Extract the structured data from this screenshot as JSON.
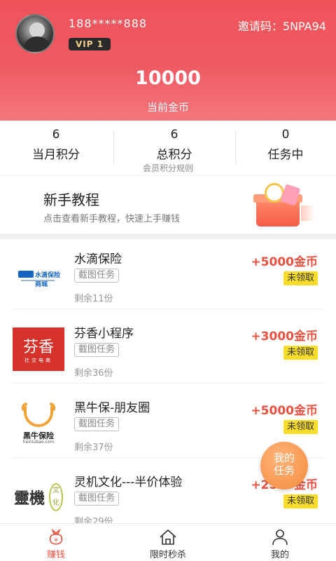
{
  "header": {
    "phone": "188*****888",
    "vip_badge": "VIP 1",
    "invite_code": "邀请码：5NPA94",
    "coins_value": "10000",
    "coins_label": "当前金币"
  },
  "stats": [
    {
      "value": "6",
      "label": "当月积分"
    },
    {
      "value": "6",
      "label": "总积分"
    },
    {
      "value": "0",
      "label": "任务中"
    }
  ],
  "rules_link": "会员积分规则",
  "tutorial": {
    "title": "新手教程",
    "subtitle": "点击查看新手教程，快速上手赚钱"
  },
  "tasks": [
    {
      "name": "水滴保险",
      "tag": "截图任务",
      "remaining": "剩余11份",
      "reward": "+5000金币",
      "status": "未领取",
      "logo_text": "水滴保险商城"
    },
    {
      "name": "芬香小程序",
      "tag": "截图任务",
      "remaining": "剩余36份",
      "reward": "+3000金币",
      "status": "未领取",
      "logo_text": "芬香",
      "logo_sub": "社交电商"
    },
    {
      "name": "黑牛保-朋友圈",
      "tag": "截图任务",
      "remaining": "剩余37份",
      "reward": "+5000金币",
      "status": "未领取",
      "logo_text": "黑牛保险",
      "logo_sub": "heiniubao.com"
    },
    {
      "name": "灵机文化---半价体验",
      "tag": "截图任务",
      "remaining": "剩余29份",
      "reward": "+2500金币",
      "status": "未领取",
      "logo_text": "靈機",
      "logo_sub": "文化"
    }
  ],
  "float_button": {
    "line1": "我的",
    "line2": "任务"
  },
  "bottom_nav": [
    {
      "label": "赚钱",
      "icon": "money-bag-icon",
      "active": true
    },
    {
      "label": "限时秒杀",
      "icon": "home-icon",
      "active": false
    },
    {
      "label": "我的",
      "icon": "user-icon",
      "active": false
    }
  ],
  "colors": {
    "header_red": "#f0525a",
    "reward_red": "#e8513f",
    "status_yellow": "#f7dc2b",
    "float_orange": "#f28a3c"
  }
}
